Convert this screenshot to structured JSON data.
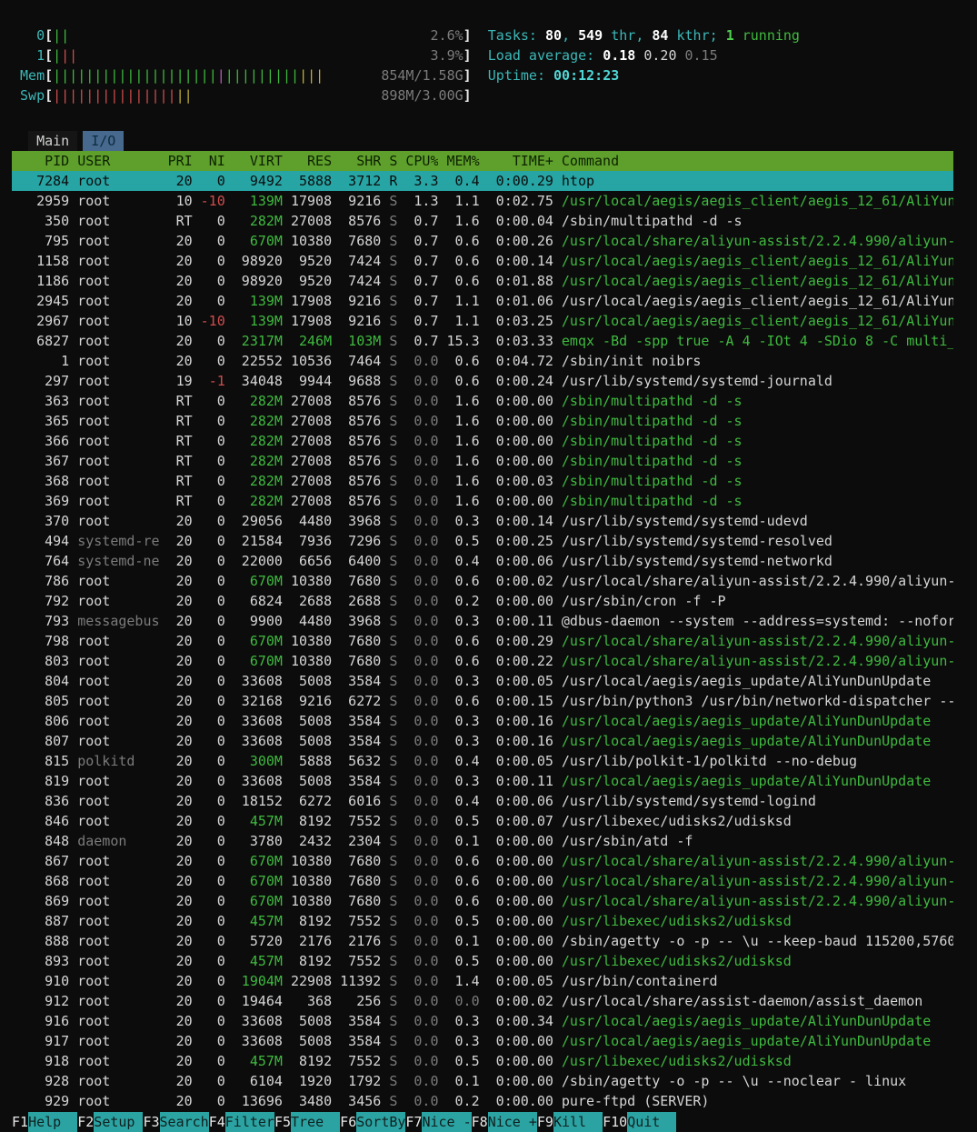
{
  "app": "htop",
  "colors": {
    "background": "#0c0c0c",
    "header_bar": "#5fa02c",
    "selected_row": "#27a5a5",
    "meter_green": "#3fba3f",
    "meter_red": "#cf4d4d",
    "meter_yellow": "#bfae3c",
    "meter_magenta": "#b85cb8",
    "label_cyan": "#3db7b7"
  },
  "header": {
    "meters": [
      {
        "name": "cpu0",
        "label": "0",
        "segments": [
          {
            "c": "green",
            "n": 2
          }
        ],
        "text": "2.6%"
      },
      {
        "name": "cpu1",
        "label": "1",
        "segments": [
          {
            "c": "green",
            "n": 1
          },
          {
            "c": "red",
            "n": 2
          }
        ],
        "text": "3.9%"
      },
      {
        "name": "mem",
        "label": "Mem",
        "segments": [
          {
            "c": "green",
            "n": 20
          },
          {
            "c": "magenta",
            "n": 1
          },
          {
            "c": "green",
            "n": 9
          },
          {
            "c": "yellow",
            "n": 3
          }
        ],
        "text": "854M/1.58G"
      },
      {
        "name": "swp",
        "label": "Swp",
        "segments": [
          {
            "c": "red",
            "n": 15
          },
          {
            "c": "yellow",
            "n": 2
          }
        ],
        "text": "898M/3.00G"
      }
    ],
    "tasks": {
      "label": "Tasks: ",
      "total": "80",
      "sep": ", ",
      "thr": "549",
      "thr_label": " thr, ",
      "kthr": "84",
      "kthr_label": " kthr; ",
      "running_count": "1",
      "running_label": " running"
    },
    "load": {
      "label": "Load average: ",
      "m1": "0.18",
      "m5": "0.20",
      "m15": "0.15"
    },
    "uptime": {
      "label": "Uptime: ",
      "value": "00:12:23"
    }
  },
  "tabs": [
    {
      "label": "Main",
      "active": true
    },
    {
      "label": "I/O",
      "active": false
    }
  ],
  "table": {
    "headers": {
      "pid": "PID",
      "user": "USER",
      "pri": "PRI",
      "ni": "NI",
      "virt": "VIRT",
      "res": "RES",
      "shr": "SHR",
      "s": "S",
      "cpu": "CPU%",
      "sort_indicator": "▽",
      "mem": "MEM%",
      "time": "TIME+",
      "cmd": "Command"
    },
    "rows": [
      {
        "pid": "7284",
        "user": "root",
        "pri": "20",
        "ni": "0",
        "virt": "9492",
        "res": "5888",
        "shr": "3712",
        "s": "R",
        "cpu": "3.3",
        "mem": "0.4",
        "time": "0:00.29",
        "cmd": "htop",
        "sel": true
      },
      {
        "pid": "2959",
        "user": "root",
        "pri": "10",
        "ni": "-10",
        "virt": "139M",
        "res": "17908",
        "shr": "9216",
        "s": "S",
        "cpu": "1.3",
        "mem": "1.1",
        "time": "0:02.75",
        "cmd": "/usr/local/aegis/aegis_client/aegis_12_61/AliYun",
        "thread": true
      },
      {
        "pid": "350",
        "user": "root",
        "pri": "RT",
        "ni": "0",
        "virt": "282M",
        "res": "27008",
        "shr": "8576",
        "s": "S",
        "cpu": "0.7",
        "mem": "1.6",
        "time": "0:00.04",
        "cmd": "/sbin/multipathd -d -s"
      },
      {
        "pid": "795",
        "user": "root",
        "pri": "20",
        "ni": "0",
        "virt": "670M",
        "res": "10380",
        "shr": "7680",
        "s": "S",
        "cpu": "0.7",
        "mem": "0.6",
        "time": "0:00.26",
        "cmd": "/usr/local/share/aliyun-assist/2.2.4.990/aliyun-",
        "thread": true
      },
      {
        "pid": "1158",
        "user": "root",
        "pri": "20",
        "ni": "0",
        "virt": "98920",
        "res": "9520",
        "shr": "7424",
        "s": "S",
        "cpu": "0.7",
        "mem": "0.6",
        "time": "0:00.14",
        "cmd": "/usr/local/aegis/aegis_client/aegis_12_61/AliYun",
        "thread": true
      },
      {
        "pid": "1186",
        "user": "root",
        "pri": "20",
        "ni": "0",
        "virt": "98920",
        "res": "9520",
        "shr": "7424",
        "s": "S",
        "cpu": "0.7",
        "mem": "0.6",
        "time": "0:01.88",
        "cmd": "/usr/local/aegis/aegis_client/aegis_12_61/AliYun",
        "thread": true
      },
      {
        "pid": "2945",
        "user": "root",
        "pri": "20",
        "ni": "0",
        "virt": "139M",
        "res": "17908",
        "shr": "9216",
        "s": "S",
        "cpu": "0.7",
        "mem": "1.1",
        "time": "0:01.06",
        "cmd": "/usr/local/aegis/aegis_client/aegis_12_61/AliYun"
      },
      {
        "pid": "2967",
        "user": "root",
        "pri": "10",
        "ni": "-10",
        "virt": "139M",
        "res": "17908",
        "shr": "9216",
        "s": "S",
        "cpu": "0.7",
        "mem": "1.1",
        "time": "0:03.25",
        "cmd": "/usr/local/aegis/aegis_client/aegis_12_61/AliYun",
        "thread": true
      },
      {
        "pid": "6827",
        "user": "root",
        "pri": "20",
        "ni": "0",
        "virt": "2317M",
        "res": "246M",
        "shr": "103M",
        "s": "S",
        "cpu": "0.7",
        "mem": "15.3",
        "time": "0:03.33",
        "cmd": "emqx -Bd -spp true -A 4 -IOt 4 -SDio 8 -C multi_",
        "thread": true
      },
      {
        "pid": "1",
        "user": "root",
        "pri": "20",
        "ni": "0",
        "virt": "22552",
        "res": "10536",
        "shr": "7464",
        "s": "S",
        "cpu": "0.0",
        "mem": "0.6",
        "time": "0:04.72",
        "cmd": "/sbin/init noibrs"
      },
      {
        "pid": "297",
        "user": "root",
        "pri": "19",
        "ni": "-1",
        "virt": "34048",
        "res": "9944",
        "shr": "9688",
        "s": "S",
        "cpu": "0.0",
        "mem": "0.6",
        "time": "0:00.24",
        "cmd": "/usr/lib/systemd/systemd-journald"
      },
      {
        "pid": "363",
        "user": "root",
        "pri": "RT",
        "ni": "0",
        "virt": "282M",
        "res": "27008",
        "shr": "8576",
        "s": "S",
        "cpu": "0.0",
        "mem": "1.6",
        "time": "0:00.00",
        "cmd": "/sbin/multipathd -d -s",
        "thread": true
      },
      {
        "pid": "365",
        "user": "root",
        "pri": "RT",
        "ni": "0",
        "virt": "282M",
        "res": "27008",
        "shr": "8576",
        "s": "S",
        "cpu": "0.0",
        "mem": "1.6",
        "time": "0:00.00",
        "cmd": "/sbin/multipathd -d -s",
        "thread": true
      },
      {
        "pid": "366",
        "user": "root",
        "pri": "RT",
        "ni": "0",
        "virt": "282M",
        "res": "27008",
        "shr": "8576",
        "s": "S",
        "cpu": "0.0",
        "mem": "1.6",
        "time": "0:00.00",
        "cmd": "/sbin/multipathd -d -s",
        "thread": true
      },
      {
        "pid": "367",
        "user": "root",
        "pri": "RT",
        "ni": "0",
        "virt": "282M",
        "res": "27008",
        "shr": "8576",
        "s": "S",
        "cpu": "0.0",
        "mem": "1.6",
        "time": "0:00.00",
        "cmd": "/sbin/multipathd -d -s",
        "thread": true
      },
      {
        "pid": "368",
        "user": "root",
        "pri": "RT",
        "ni": "0",
        "virt": "282M",
        "res": "27008",
        "shr": "8576",
        "s": "S",
        "cpu": "0.0",
        "mem": "1.6",
        "time": "0:00.03",
        "cmd": "/sbin/multipathd -d -s",
        "thread": true
      },
      {
        "pid": "369",
        "user": "root",
        "pri": "RT",
        "ni": "0",
        "virt": "282M",
        "res": "27008",
        "shr": "8576",
        "s": "S",
        "cpu": "0.0",
        "mem": "1.6",
        "time": "0:00.00",
        "cmd": "/sbin/multipathd -d -s",
        "thread": true
      },
      {
        "pid": "370",
        "user": "root",
        "pri": "20",
        "ni": "0",
        "virt": "29056",
        "res": "4480",
        "shr": "3968",
        "s": "S",
        "cpu": "0.0",
        "mem": "0.3",
        "time": "0:00.14",
        "cmd": "/usr/lib/systemd/systemd-udevd"
      },
      {
        "pid": "494",
        "user": "systemd-re",
        "pri": "20",
        "ni": "0",
        "virt": "21584",
        "res": "7936",
        "shr": "7296",
        "s": "S",
        "cpu": "0.0",
        "mem": "0.5",
        "time": "0:00.25",
        "cmd": "/usr/lib/systemd/systemd-resolved"
      },
      {
        "pid": "764",
        "user": "systemd-ne",
        "pri": "20",
        "ni": "0",
        "virt": "22000",
        "res": "6656",
        "shr": "6400",
        "s": "S",
        "cpu": "0.0",
        "mem": "0.4",
        "time": "0:00.06",
        "cmd": "/usr/lib/systemd/systemd-networkd"
      },
      {
        "pid": "786",
        "user": "root",
        "pri": "20",
        "ni": "0",
        "virt": "670M",
        "res": "10380",
        "shr": "7680",
        "s": "S",
        "cpu": "0.0",
        "mem": "0.6",
        "time": "0:00.02",
        "cmd": "/usr/local/share/aliyun-assist/2.2.4.990/aliyun-"
      },
      {
        "pid": "792",
        "user": "root",
        "pri": "20",
        "ni": "0",
        "virt": "6824",
        "res": "2688",
        "shr": "2688",
        "s": "S",
        "cpu": "0.0",
        "mem": "0.2",
        "time": "0:00.00",
        "cmd": "/usr/sbin/cron -f -P"
      },
      {
        "pid": "793",
        "user": "messagebus",
        "pri": "20",
        "ni": "0",
        "virt": "9900",
        "res": "4480",
        "shr": "3968",
        "s": "S",
        "cpu": "0.0",
        "mem": "0.3",
        "time": "0:00.11",
        "cmd": "@dbus-daemon --system --address=systemd: --nofor"
      },
      {
        "pid": "798",
        "user": "root",
        "pri": "20",
        "ni": "0",
        "virt": "670M",
        "res": "10380",
        "shr": "7680",
        "s": "S",
        "cpu": "0.0",
        "mem": "0.6",
        "time": "0:00.29",
        "cmd": "/usr/local/share/aliyun-assist/2.2.4.990/aliyun-",
        "thread": true
      },
      {
        "pid": "803",
        "user": "root",
        "pri": "20",
        "ni": "0",
        "virt": "670M",
        "res": "10380",
        "shr": "7680",
        "s": "S",
        "cpu": "0.0",
        "mem": "0.6",
        "time": "0:00.22",
        "cmd": "/usr/local/share/aliyun-assist/2.2.4.990/aliyun-",
        "thread": true
      },
      {
        "pid": "804",
        "user": "root",
        "pri": "20",
        "ni": "0",
        "virt": "33608",
        "res": "5008",
        "shr": "3584",
        "s": "S",
        "cpu": "0.0",
        "mem": "0.3",
        "time": "0:00.05",
        "cmd": "/usr/local/aegis/aegis_update/AliYunDunUpdate"
      },
      {
        "pid": "805",
        "user": "root",
        "pri": "20",
        "ni": "0",
        "virt": "32168",
        "res": "9216",
        "shr": "6272",
        "s": "S",
        "cpu": "0.0",
        "mem": "0.6",
        "time": "0:00.15",
        "cmd": "/usr/bin/python3 /usr/bin/networkd-dispatcher --"
      },
      {
        "pid": "806",
        "user": "root",
        "pri": "20",
        "ni": "0",
        "virt": "33608",
        "res": "5008",
        "shr": "3584",
        "s": "S",
        "cpu": "0.0",
        "mem": "0.3",
        "time": "0:00.16",
        "cmd": "/usr/local/aegis/aegis_update/AliYunDunUpdate",
        "thread": true
      },
      {
        "pid": "807",
        "user": "root",
        "pri": "20",
        "ni": "0",
        "virt": "33608",
        "res": "5008",
        "shr": "3584",
        "s": "S",
        "cpu": "0.0",
        "mem": "0.3",
        "time": "0:00.16",
        "cmd": "/usr/local/aegis/aegis_update/AliYunDunUpdate",
        "thread": true
      },
      {
        "pid": "815",
        "user": "polkitd",
        "pri": "20",
        "ni": "0",
        "virt": "300M",
        "res": "5888",
        "shr": "5632",
        "s": "S",
        "cpu": "0.0",
        "mem": "0.4",
        "time": "0:00.05",
        "cmd": "/usr/lib/polkit-1/polkitd --no-debug"
      },
      {
        "pid": "819",
        "user": "root",
        "pri": "20",
        "ni": "0",
        "virt": "33608",
        "res": "5008",
        "shr": "3584",
        "s": "S",
        "cpu": "0.0",
        "mem": "0.3",
        "time": "0:00.11",
        "cmd": "/usr/local/aegis/aegis_update/AliYunDunUpdate",
        "thread": true
      },
      {
        "pid": "836",
        "user": "root",
        "pri": "20",
        "ni": "0",
        "virt": "18152",
        "res": "6272",
        "shr": "6016",
        "s": "S",
        "cpu": "0.0",
        "mem": "0.4",
        "time": "0:00.06",
        "cmd": "/usr/lib/systemd/systemd-logind"
      },
      {
        "pid": "846",
        "user": "root",
        "pri": "20",
        "ni": "0",
        "virt": "457M",
        "res": "8192",
        "shr": "7552",
        "s": "S",
        "cpu": "0.0",
        "mem": "0.5",
        "time": "0:00.07",
        "cmd": "/usr/libexec/udisks2/udisksd"
      },
      {
        "pid": "848",
        "user": "daemon",
        "pri": "20",
        "ni": "0",
        "virt": "3780",
        "res": "2432",
        "shr": "2304",
        "s": "S",
        "cpu": "0.0",
        "mem": "0.1",
        "time": "0:00.00",
        "cmd": "/usr/sbin/atd -f"
      },
      {
        "pid": "867",
        "user": "root",
        "pri": "20",
        "ni": "0",
        "virt": "670M",
        "res": "10380",
        "shr": "7680",
        "s": "S",
        "cpu": "0.0",
        "mem": "0.6",
        "time": "0:00.00",
        "cmd": "/usr/local/share/aliyun-assist/2.2.4.990/aliyun-",
        "thread": true
      },
      {
        "pid": "868",
        "user": "root",
        "pri": "20",
        "ni": "0",
        "virt": "670M",
        "res": "10380",
        "shr": "7680",
        "s": "S",
        "cpu": "0.0",
        "mem": "0.6",
        "time": "0:00.00",
        "cmd": "/usr/local/share/aliyun-assist/2.2.4.990/aliyun-",
        "thread": true
      },
      {
        "pid": "869",
        "user": "root",
        "pri": "20",
        "ni": "0",
        "virt": "670M",
        "res": "10380",
        "shr": "7680",
        "s": "S",
        "cpu": "0.0",
        "mem": "0.6",
        "time": "0:00.00",
        "cmd": "/usr/local/share/aliyun-assist/2.2.4.990/aliyun-",
        "thread": true
      },
      {
        "pid": "887",
        "user": "root",
        "pri": "20",
        "ni": "0",
        "virt": "457M",
        "res": "8192",
        "shr": "7552",
        "s": "S",
        "cpu": "0.0",
        "mem": "0.5",
        "time": "0:00.00",
        "cmd": "/usr/libexec/udisks2/udisksd",
        "thread": true
      },
      {
        "pid": "888",
        "user": "root",
        "pri": "20",
        "ni": "0",
        "virt": "5720",
        "res": "2176",
        "shr": "2176",
        "s": "S",
        "cpu": "0.0",
        "mem": "0.1",
        "time": "0:00.00",
        "cmd": "/sbin/agetty -o -p -- \\u --keep-baud 115200,5760"
      },
      {
        "pid": "893",
        "user": "root",
        "pri": "20",
        "ni": "0",
        "virt": "457M",
        "res": "8192",
        "shr": "7552",
        "s": "S",
        "cpu": "0.0",
        "mem": "0.5",
        "time": "0:00.00",
        "cmd": "/usr/libexec/udisks2/udisksd",
        "thread": true
      },
      {
        "pid": "910",
        "user": "root",
        "pri": "20",
        "ni": "0",
        "virt": "1904M",
        "res": "22908",
        "shr": "11392",
        "s": "S",
        "cpu": "0.0",
        "mem": "1.4",
        "time": "0:00.05",
        "cmd": "/usr/bin/containerd"
      },
      {
        "pid": "912",
        "user": "root",
        "pri": "20",
        "ni": "0",
        "virt": "19464",
        "res": "368",
        "shr": "256",
        "s": "S",
        "cpu": "0.0",
        "mem": "0.0",
        "time": "0:00.02",
        "cmd": "/usr/local/share/assist-daemon/assist_daemon"
      },
      {
        "pid": "916",
        "user": "root",
        "pri": "20",
        "ni": "0",
        "virt": "33608",
        "res": "5008",
        "shr": "3584",
        "s": "S",
        "cpu": "0.0",
        "mem": "0.3",
        "time": "0:00.34",
        "cmd": "/usr/local/aegis/aegis_update/AliYunDunUpdate",
        "thread": true
      },
      {
        "pid": "917",
        "user": "root",
        "pri": "20",
        "ni": "0",
        "virt": "33608",
        "res": "5008",
        "shr": "3584",
        "s": "S",
        "cpu": "0.0",
        "mem": "0.3",
        "time": "0:00.00",
        "cmd": "/usr/local/aegis/aegis_update/AliYunDunUpdate",
        "thread": true
      },
      {
        "pid": "918",
        "user": "root",
        "pri": "20",
        "ni": "0",
        "virt": "457M",
        "res": "8192",
        "shr": "7552",
        "s": "S",
        "cpu": "0.0",
        "mem": "0.5",
        "time": "0:00.00",
        "cmd": "/usr/libexec/udisks2/udisksd",
        "thread": true
      },
      {
        "pid": "928",
        "user": "root",
        "pri": "20",
        "ni": "0",
        "virt": "6104",
        "res": "1920",
        "shr": "1792",
        "s": "S",
        "cpu": "0.0",
        "mem": "0.1",
        "time": "0:00.00",
        "cmd": "/sbin/agetty -o -p -- \\u --noclear - linux"
      },
      {
        "pid": "929",
        "user": "root",
        "pri": "20",
        "ni": "0",
        "virt": "13696",
        "res": "3480",
        "shr": "3456",
        "s": "S",
        "cpu": "0.0",
        "mem": "0.2",
        "time": "0:00.00",
        "cmd": "pure-ftpd (SERVER)"
      }
    ]
  },
  "fkeys": [
    {
      "key": "F1",
      "label": "Help"
    },
    {
      "key": "F2",
      "label": "Setup"
    },
    {
      "key": "F3",
      "label": "Search"
    },
    {
      "key": "F4",
      "label": "Filter"
    },
    {
      "key": "F5",
      "label": "Tree"
    },
    {
      "key": "F6",
      "label": "SortBy"
    },
    {
      "key": "F7",
      "label": "Nice -"
    },
    {
      "key": "F8",
      "label": "Nice +"
    },
    {
      "key": "F9",
      "label": "Kill"
    },
    {
      "key": "F10",
      "label": "Quit"
    }
  ]
}
